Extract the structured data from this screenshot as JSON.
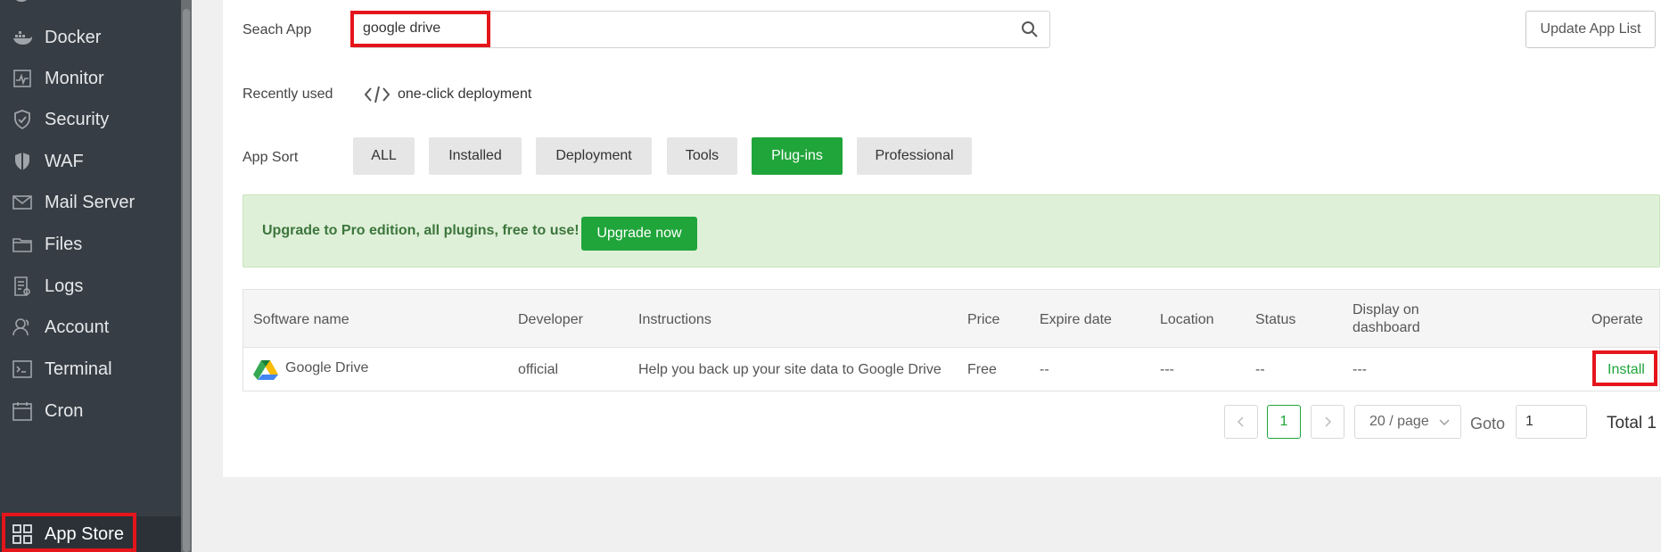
{
  "sidebar": {
    "items": [
      {
        "label": "Docker",
        "icon": "docker-icon"
      },
      {
        "label": "Monitor",
        "icon": "monitor-icon"
      },
      {
        "label": "Security",
        "icon": "shield-icon"
      },
      {
        "label": "WAF",
        "icon": "waf-shield-icon"
      },
      {
        "label": "Mail Server",
        "icon": "mail-icon"
      },
      {
        "label": "Files",
        "icon": "folder-icon"
      },
      {
        "label": "Logs",
        "icon": "logs-icon"
      },
      {
        "label": "Account",
        "icon": "account-icon"
      },
      {
        "label": "Terminal",
        "icon": "terminal-icon"
      },
      {
        "label": "Cron",
        "icon": "calendar-icon"
      },
      {
        "label": "App Store",
        "icon": "grid-icon",
        "active": true
      }
    ]
  },
  "search": {
    "label": "Seach App",
    "value": "google drive"
  },
  "update_button": "Update App List",
  "recent": {
    "label": "Recently used",
    "link": "one-click deployment"
  },
  "sort": {
    "label": "App Sort",
    "options": [
      "ALL",
      "Installed",
      "Deployment",
      "Tools",
      "Plug-ins",
      "Professional"
    ],
    "active": "Plug-ins"
  },
  "banner": {
    "text": "Upgrade to Pro edition, all plugins, free to use!",
    "button": "Upgrade now"
  },
  "table": {
    "headers": {
      "name": "Software name",
      "developer": "Developer",
      "instructions": "Instructions",
      "price": "Price",
      "expire": "Expire date",
      "location": "Location",
      "status": "Status",
      "dashboard_line1": "Display on",
      "dashboard_line2": "dashboard",
      "operate": "Operate"
    },
    "rows": [
      {
        "name": "Google Drive",
        "developer": "official",
        "instructions": "Help you back up your site data to Google Drive",
        "price": "Free",
        "expire": "--",
        "location": "---",
        "status": "--",
        "dashboard": "---",
        "operate": "Install"
      }
    ]
  },
  "pagination": {
    "current_page": "1",
    "per_page": "20 / page",
    "goto_label": "Goto",
    "goto_value": "1",
    "total": "Total 1"
  },
  "colors": {
    "sidebar_bg": "#363d44",
    "accent_green": "#20a53a",
    "highlight_red": "#e5151c",
    "banner_bg": "#dff0d8"
  }
}
